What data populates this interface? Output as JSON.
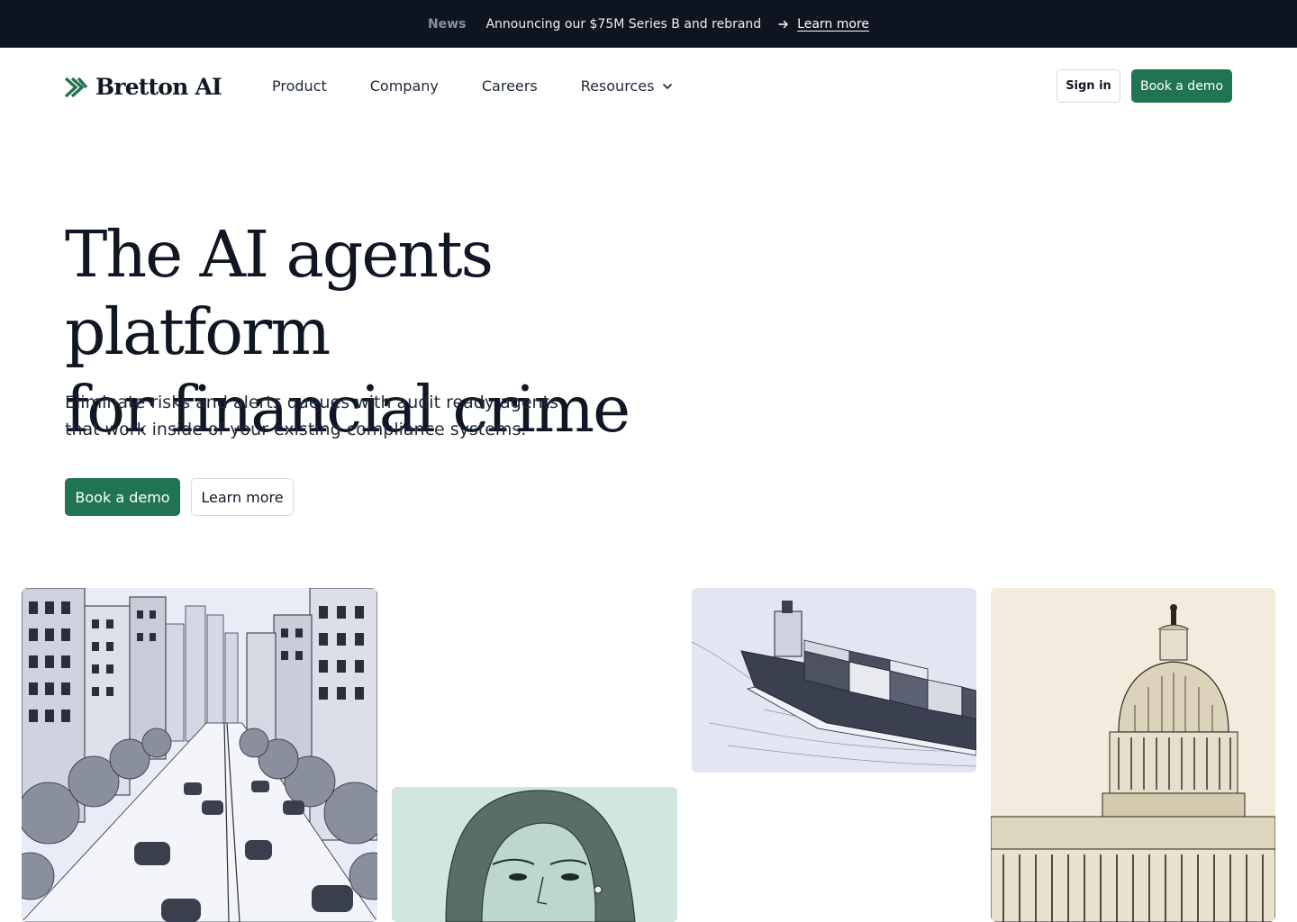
{
  "announcement": {
    "tag": "News",
    "message": "Announcing our $75M Series B and rebrand",
    "link_label": "Learn more"
  },
  "nav": {
    "brand": "Bretton AI",
    "links": [
      "Product",
      "Company",
      "Careers",
      "Resources"
    ],
    "signin_label": "Sign in",
    "demo_label": "Book a demo"
  },
  "hero": {
    "title_line1": "The AI agents platform",
    "title_line2": "for financial crime",
    "subtitle_line1": "Eliminate risks and alerts queues with audit ready agents",
    "subtitle_line2": "that work inside of your existing compliance systems.",
    "primary_label": "Book a demo",
    "secondary_label": "Learn more"
  },
  "gallery": [
    {
      "name": "city-street-illustration"
    },
    {
      "name": "woman-portrait-illustration"
    },
    {
      "name": "container-ship-illustration"
    },
    {
      "name": "capitol-building-illustration"
    }
  ],
  "colors": {
    "brand_green": "#217452",
    "announcement_bg": "#0e1420",
    "text_dark": "#101623"
  },
  "icons": {
    "logo": "chevron-stripes-logo",
    "announcement_arrow": "arrow-right-icon",
    "resources_dropdown": "chevron-down-icon"
  }
}
